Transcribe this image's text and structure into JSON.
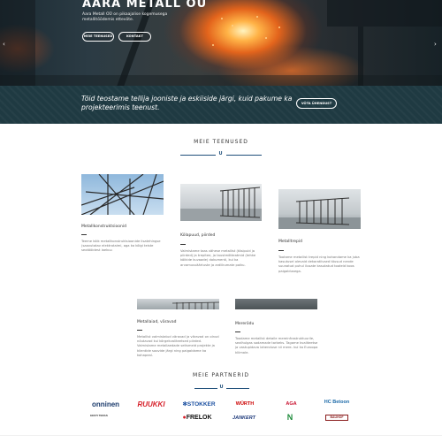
{
  "hero": {
    "title": "AARA METALL OÜ",
    "subtitle": "Aara Metall OÜ on pikaajalise kogemusega metallitöödemis ettevõte.",
    "buttons": [
      {
        "label": "MEIE TEENUSED"
      },
      {
        "label": "KONTAKT"
      }
    ],
    "prev_icon": "chevron-left-icon",
    "next_icon": "chevron-right-icon"
  },
  "banner": {
    "text": "Töid teostame tellija jooniste ja eskiiside järgi, kuid pakume ka projekteerimis teenust.",
    "button_label": "VÕTA ÜHENDUST",
    "background_color": "#1f3a42"
  },
  "services": {
    "heading": "MEIE TEENUSED",
    "divider_icon": "U",
    "items": [
      {
        "title": "Metallkonstruktsioonid",
        "description": "Teeme kõik metallkonstruktsioonide lisatehingse (saavutatav elektrotaimi, aga ka kõigi teiste seotööidest laekuv."
      },
      {
        "title": "Kõlapuud, piirded",
        "description": "Valmistame taas vähese metallist (tõsipuid ja piirded) ja trepitee, ja taustmõtteatmid (tehke kõikide kuvaade) dokumenti, kui ka arvamusväärtuste ja ardlikumate paiku."
      },
      {
        "title": "Metalltrepid",
        "description": "Tootame metallist trepid ning kohandame ka juba kasutusel olevaid dekoratiivsed tõusud nende suunatud puhul ilusate kasutatud tooteid koos paigaldusega."
      },
      {
        "title": "Metallaiad, väravad",
        "description": "Metallist valmistatud väravad ja väravad on olnud nõutavad kui kõrgekvaliteetsed piirded. Valmistame metallaedade seitsmeid projekte ja klientide soovide järgi ning paigaldame ka kohapeal."
      },
      {
        "title": "Mererõdu",
        "description": "Toodame metallist detaile mereinfrastruktuurile, sealhulgas sadamade tarbeks. Tagame kvaliteetse ja vastupidava lahenduse nii mere- kui ka Euroopa kliimale."
      }
    ]
  },
  "partners": {
    "heading": "MEIE PARTNERID",
    "divider_icon": "U",
    "logos": [
      {
        "name": "onninen",
        "color": "#1a3a6b"
      },
      {
        "name": "RUUKKI",
        "color": "#d6202a"
      },
      {
        "name": "STOKKER",
        "color": "#1a4fa0"
      },
      {
        "name": "WÜRTH",
        "color": "#cc0000"
      },
      {
        "name": "AGA",
        "color": "#c8102e"
      },
      {
        "name": "HC Betoon",
        "color": "#1c6aa8"
      },
      {
        "name": "EESTI TERAS",
        "color": "#333333"
      },
      {
        "name": "FRELOK",
        "color": "#111111"
      },
      {
        "name": "JANKERT",
        "color": "#1e3a7b"
      },
      {
        "name": "N",
        "color": "#1d8a3a"
      },
      {
        "name": "BAUHOF",
        "color": "#8a1c1c"
      }
    ]
  }
}
